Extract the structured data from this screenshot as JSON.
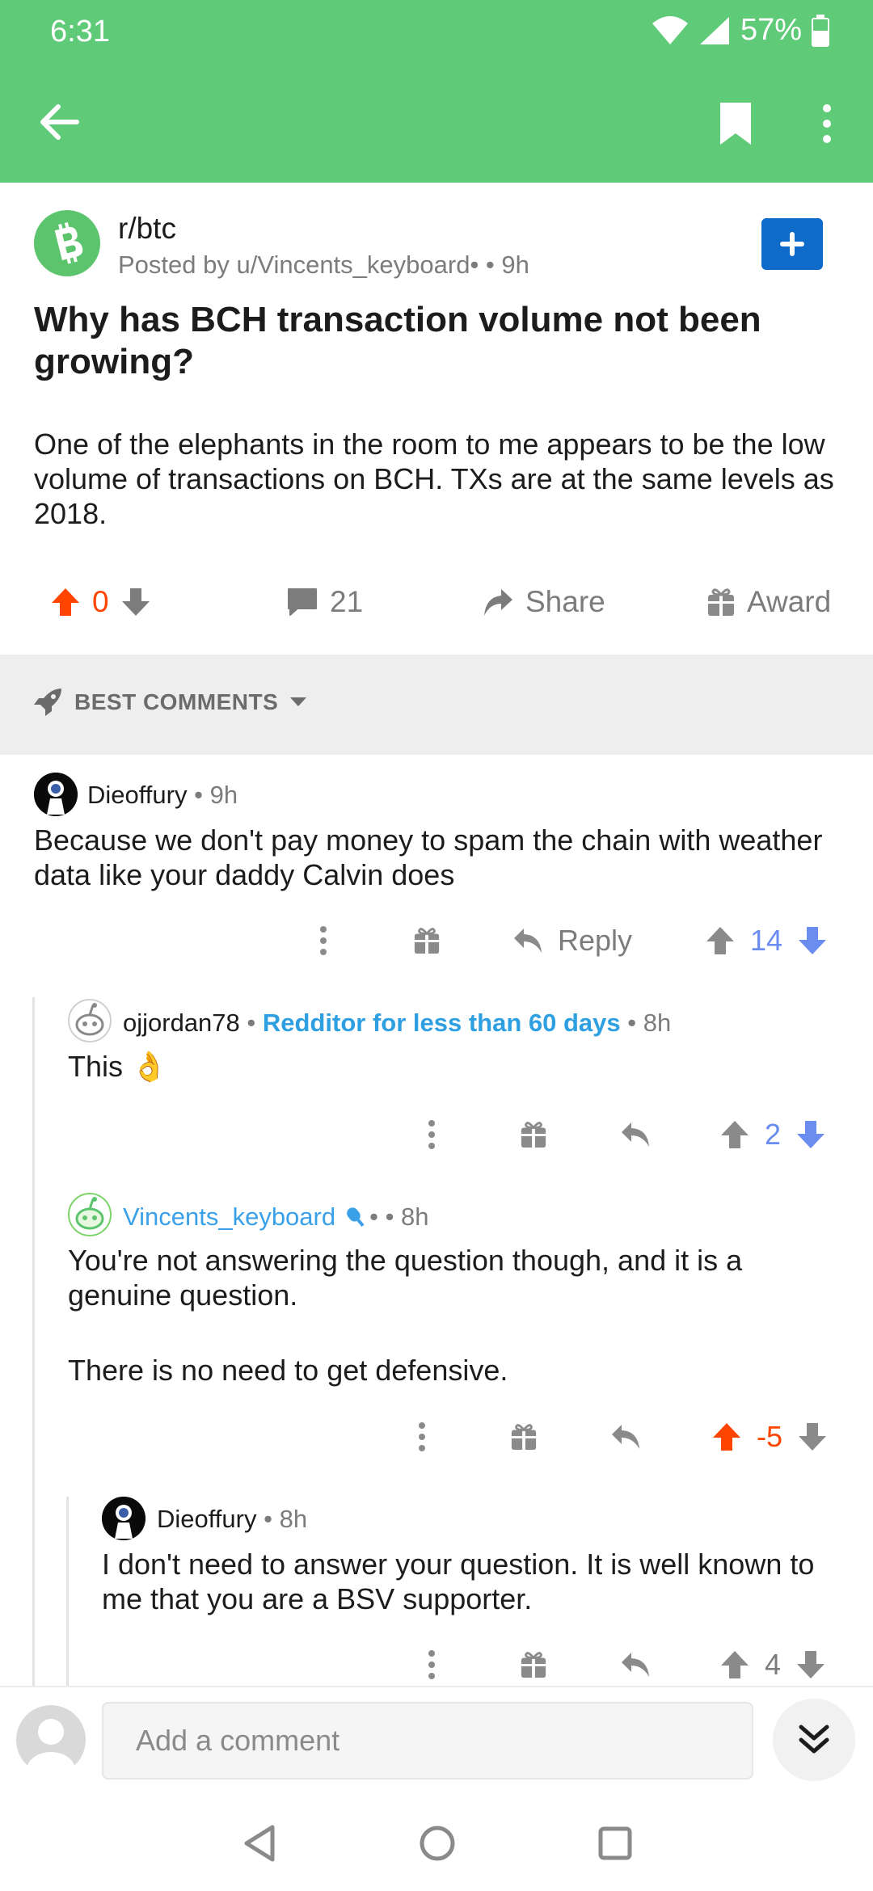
{
  "status_bar": {
    "time": "6:31",
    "battery": "57%"
  },
  "toolbar": {
    "back": "back",
    "bookmark": "bookmark",
    "more": "more"
  },
  "post": {
    "subreddit": "r/btc",
    "posted_by": "Posted by u/Vincents_keyboard• • 9h",
    "title": "Why has BCH transaction volume not been growing?",
    "body": "One of the elephants in the room to me appears to be the low volume of transactions on BCH.  TXs are at the same levels as 2018.",
    "score": "0",
    "comments": "21",
    "share_label": "Share",
    "award_label": "Award"
  },
  "sort": {
    "label": "BEST COMMENTS"
  },
  "comments": [
    {
      "user": "Dieoffury",
      "age": " • 9h",
      "body": "Because we don't pay money to spam the chain with weather data like your daddy Calvin does",
      "reply_label": "Reply",
      "score": "14"
    },
    {
      "user": "ojjordan78",
      "flair": "Redditor for less than 60 days",
      "age": " • 8h",
      "body": "This 👌",
      "score": "2"
    },
    {
      "user": "Vincents_keyboard",
      "age": " • • 8h",
      "body_1": "You're not answering the question though, and it is a genuine question.",
      "body_2": "There is no need to get defensive.",
      "score": "-5"
    },
    {
      "user": "Dieoffury",
      "age": " • 8h",
      "body": "I don't need to answer your question. It is well known to me that you are a BSV supporter.",
      "score": "4"
    }
  ],
  "composer": {
    "placeholder": "Add a comment"
  },
  "colors": {
    "toolbar": "#5fca78",
    "upvote": "#ff4500",
    "downvote": "#6b8df0",
    "join": "#0f6bc9"
  }
}
